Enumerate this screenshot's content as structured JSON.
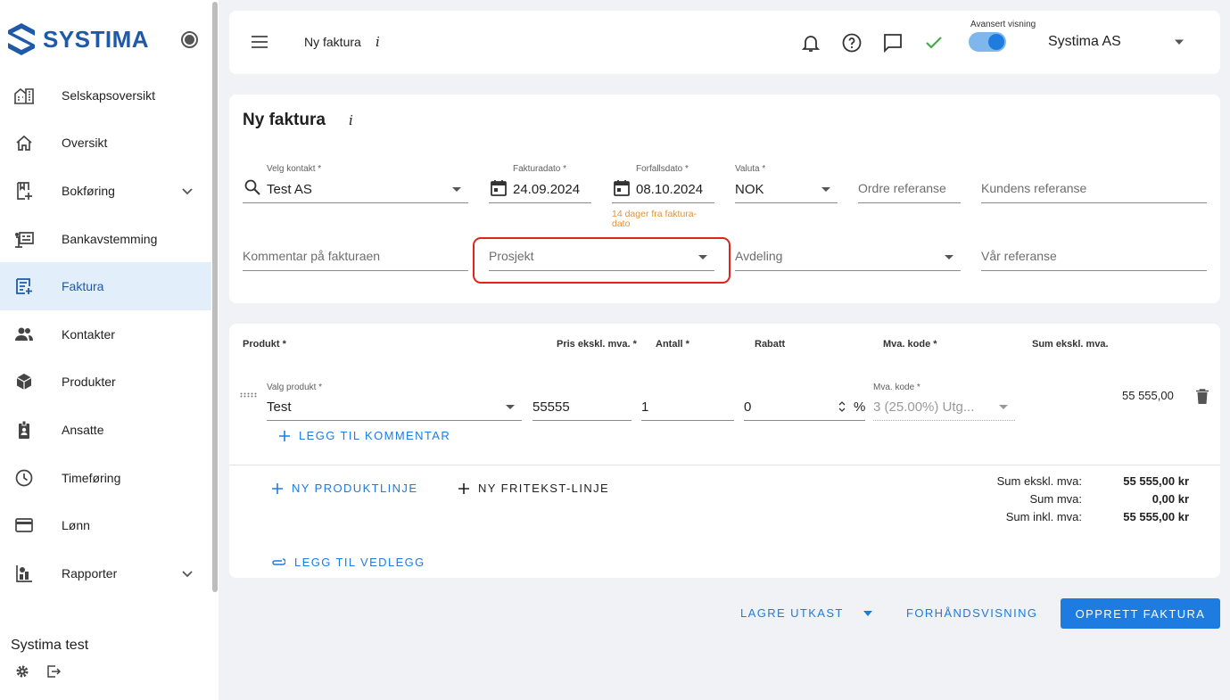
{
  "brand": {
    "name": "SYSTIMA"
  },
  "sidebar": {
    "items": [
      {
        "label": "Selskapsoversikt",
        "icon": "building-icon"
      },
      {
        "label": "Oversikt",
        "icon": "home-icon"
      },
      {
        "label": "Bokføring",
        "icon": "book-plus-icon",
        "expandable": true
      },
      {
        "label": "Bankavstemming",
        "icon": "bank-icon"
      },
      {
        "label": "Faktura",
        "icon": "invoice-icon",
        "active": true
      },
      {
        "label": "Kontakter",
        "icon": "people-icon"
      },
      {
        "label": "Produkter",
        "icon": "box-icon"
      },
      {
        "label": "Ansatte",
        "icon": "badge-icon"
      },
      {
        "label": "Timeføring",
        "icon": "clock-icon"
      },
      {
        "label": "Lønn",
        "icon": "card-icon"
      },
      {
        "label": "Rapporter",
        "icon": "chart-icon",
        "expandable": true
      }
    ],
    "company": "Systima test"
  },
  "topbar": {
    "title": "Ny faktura",
    "info": "i",
    "advanced_label": "Avansert visning",
    "org": "Systima AS"
  },
  "form": {
    "title": "Ny faktura",
    "info": "i",
    "contact": {
      "label": "Velg kontakt *",
      "value": "Test AS"
    },
    "invoice_date": {
      "label": "Fakturadato *",
      "value": "24.09.2024"
    },
    "due_date": {
      "label": "Forfallsdato *",
      "value": "08.10.2024",
      "hint": "14 dager fra faktura-dato"
    },
    "currency": {
      "label": "Valuta *",
      "value": "NOK"
    },
    "order_ref": {
      "placeholder": "Ordre referanse"
    },
    "customer_ref": {
      "placeholder": "Kundens referanse"
    },
    "comment": {
      "placeholder": "Kommentar på fakturaen"
    },
    "project": {
      "placeholder": "Prosjekt"
    },
    "department": {
      "placeholder": "Avdeling"
    },
    "our_ref": {
      "placeholder": "Vår referanse"
    }
  },
  "lines": {
    "headers": {
      "product": "Produkt *",
      "price": "Pris ekskl. mva. *",
      "qty": "Antall *",
      "discount": "Rabatt",
      "vat": "Mva. kode *",
      "sum": "Sum ekskl. mva."
    },
    "row": {
      "product_label": "Valg produkt *",
      "product": "Test",
      "price": "55555",
      "qty": "1",
      "discount": "0",
      "percent": "%",
      "vat_label": "Mva. kode *",
      "vat": "3 (25.00%) Utg...",
      "total": "55 555,00"
    },
    "add_comment": "LEGG TIL KOMMENTAR",
    "new_product_line": "NY PRODUKTLINJE",
    "new_text_line": "NY FRITEKST-LINJE",
    "add_attachment": "LEGG TIL VEDLEGG",
    "totals": [
      {
        "label": "Sum ekskl. mva:",
        "value": "55 555,00 kr"
      },
      {
        "label": "Sum mva:",
        "value": "0,00 kr"
      },
      {
        "label": "Sum inkl. mva:",
        "value": "55 555,00 kr"
      }
    ]
  },
  "actions": {
    "save_draft": "LAGRE UTKAST",
    "preview": "FORHÅNDSVISNING",
    "create": "OPPRETT FAKTURA"
  },
  "colors": {
    "accent": "#1e7be0",
    "active_bg": "#e3eefb",
    "hint": "#e8912e",
    "highlight": "#e0241b",
    "success": "#3fae4a"
  }
}
